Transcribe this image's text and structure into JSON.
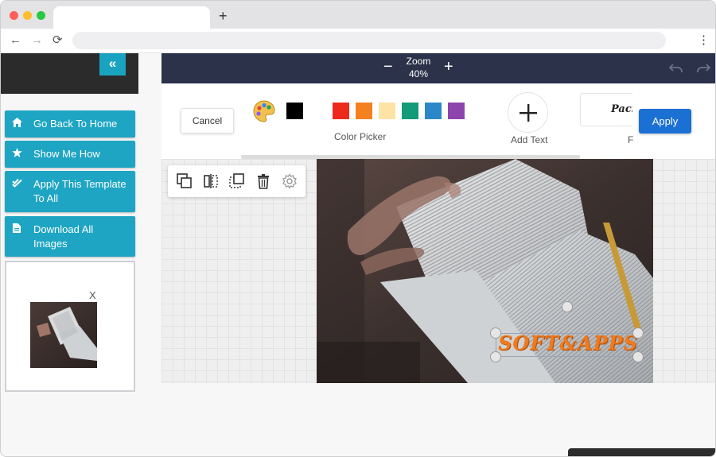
{
  "browser": {
    "new_tab_label": "+",
    "back_label": "←",
    "forward_label": "→",
    "reload_label": "⟳",
    "menu_label": "⋮"
  },
  "sidebar": {
    "collapse_label": "«",
    "buttons": [
      {
        "label": "Go Back To Home",
        "icon": "home-icon"
      },
      {
        "label": "Show Me How",
        "icon": "star-icon"
      },
      {
        "label": "Apply This Template To All",
        "icon": "double-check-icon"
      },
      {
        "label": "Download All Images",
        "icon": "file-icon"
      }
    ],
    "thumbnail_close": "X"
  },
  "topbar": {
    "zoom_label": "Zoom",
    "zoom_value": "40%",
    "zoom_minus": "−",
    "zoom_plus": "+"
  },
  "toolbar": {
    "cancel_label": "Cancel",
    "colors": [
      "#000000",
      "#ee2a1d",
      "#f5801f",
      "#fde4a4",
      "#139a78",
      "#2b88c8",
      "#8e44ad"
    ],
    "color_picker_label": "Color Picker",
    "add_text_label": "Add Text",
    "font_preview": "Pacific",
    "font_label": "F",
    "apply_label": "Apply"
  },
  "canvas": {
    "text_overlay": "SOFT&APPS",
    "text_color": "#f07a1e"
  },
  "context_toolbar": [
    "duplicate-icon",
    "flip-icon",
    "send-back-icon",
    "delete-icon",
    "settings-icon"
  ]
}
